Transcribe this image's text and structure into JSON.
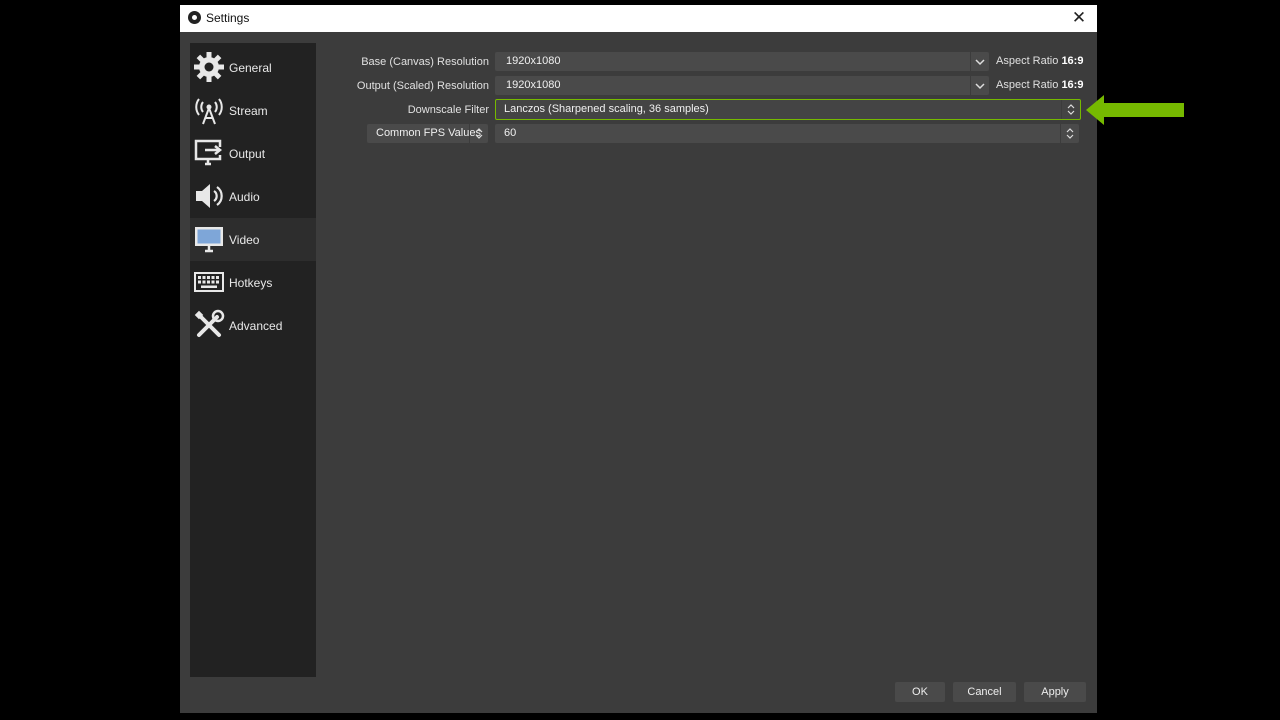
{
  "window": {
    "title": "Settings",
    "close_icon": "close-icon"
  },
  "sidebar": {
    "items": [
      {
        "label": "General",
        "icon": "gear-icon"
      },
      {
        "label": "Stream",
        "icon": "antenna-icon"
      },
      {
        "label": "Output",
        "icon": "output-icon"
      },
      {
        "label": "Audio",
        "icon": "speaker-icon"
      },
      {
        "label": "Video",
        "icon": "monitor-icon",
        "selected": true
      },
      {
        "label": "Hotkeys",
        "icon": "keyboard-icon"
      },
      {
        "label": "Advanced",
        "icon": "tools-icon"
      }
    ]
  },
  "video": {
    "base_label": "Base (Canvas) Resolution",
    "base_value": "1920x1080",
    "base_aspect_prefix": "Aspect Ratio",
    "base_aspect_value": "16:9",
    "output_label": "Output (Scaled) Resolution",
    "output_value": "1920x1080",
    "output_aspect_prefix": "Aspect Ratio",
    "output_aspect_value": "16:9",
    "downscale_label": "Downscale Filter",
    "downscale_value": "Lanczos (Sharpened scaling, 36 samples)",
    "fps_type_value": "Common FPS Values",
    "fps_value": "60"
  },
  "buttons": {
    "ok": "OK",
    "cancel": "Cancel",
    "apply": "Apply"
  },
  "colors": {
    "highlight": "#76b900",
    "window_bg": "#3c3c3c",
    "sidebar_bg": "#222222"
  }
}
